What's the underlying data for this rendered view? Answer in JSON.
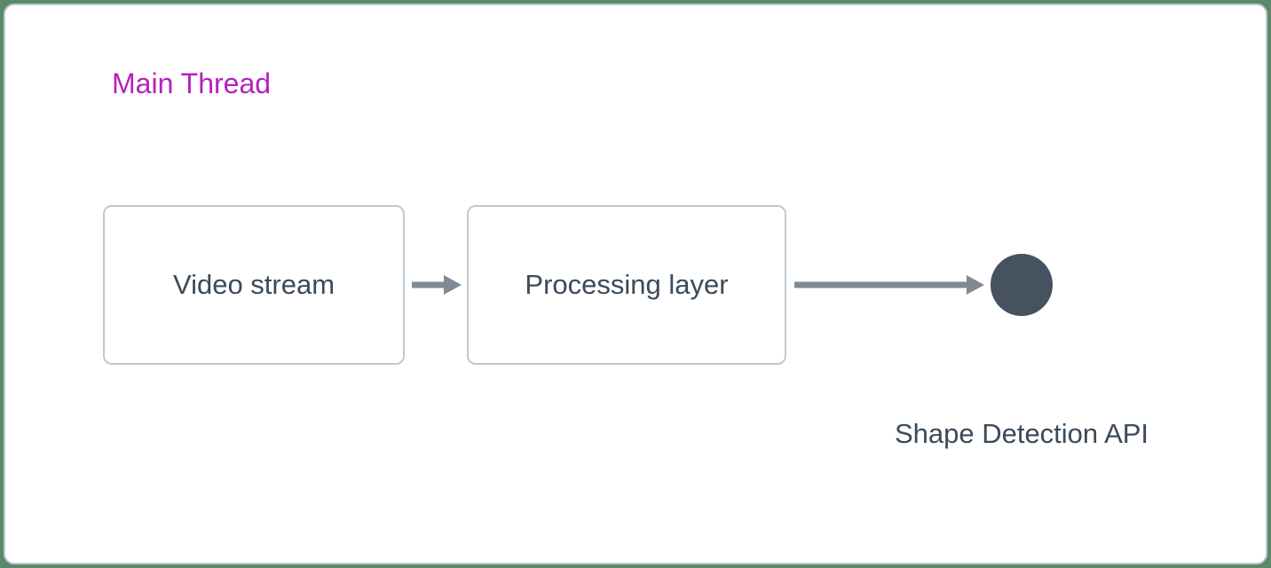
{
  "title": "Main Thread",
  "nodes": {
    "video_stream": "Video stream",
    "processing_layer": "Processing layer",
    "shape_detection_api": "Shape Detection API"
  },
  "colors": {
    "title": "#b820bc",
    "border": "#bccad6",
    "text": "#3b4a59",
    "node_fill": "#46525f",
    "arrow": "#808a94"
  }
}
